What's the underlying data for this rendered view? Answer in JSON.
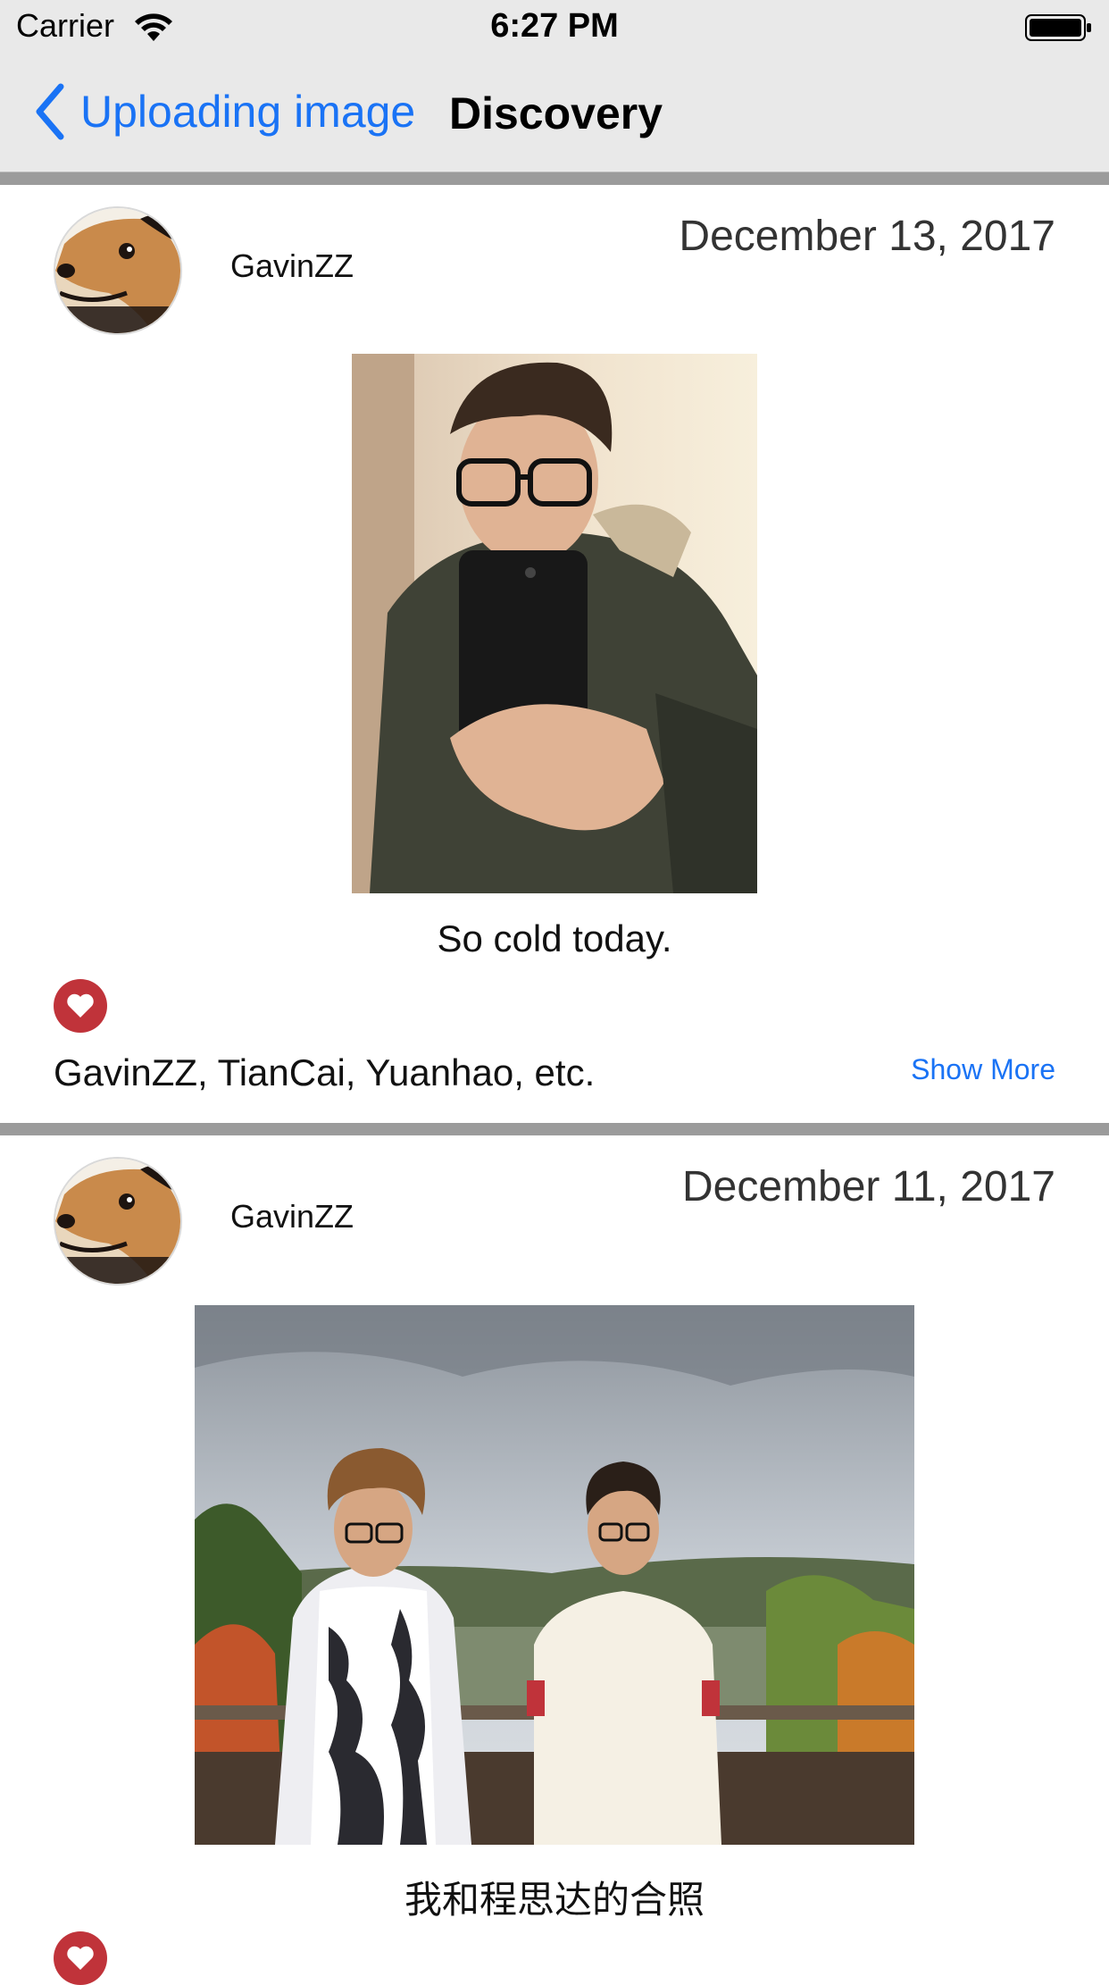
{
  "status_bar": {
    "carrier": "Carrier",
    "time": "6:27 PM",
    "wifi_icon": "wifi-icon",
    "battery_icon": "battery-full-icon"
  },
  "nav": {
    "back_label": "Uploading image",
    "back_icon": "chevron-left-icon",
    "title": "Discovery",
    "accent_color": "#1a73f5"
  },
  "posts": [
    {
      "username": "GavinZZ",
      "date": "December 13, 2017",
      "caption": "So cold today.",
      "like_icon": "heart-icon",
      "likers": "GavinZZ, TianCai, Yuanhao, etc.",
      "show_more": "Show More"
    },
    {
      "username": "GavinZZ",
      "date": "December 11, 2017",
      "caption": "我和程思达的合照",
      "like_icon": "heart-icon"
    }
  ],
  "colors": {
    "like": "#c0333a",
    "separator": "#9b9b9b",
    "bar_background": "#e9e9e9"
  }
}
